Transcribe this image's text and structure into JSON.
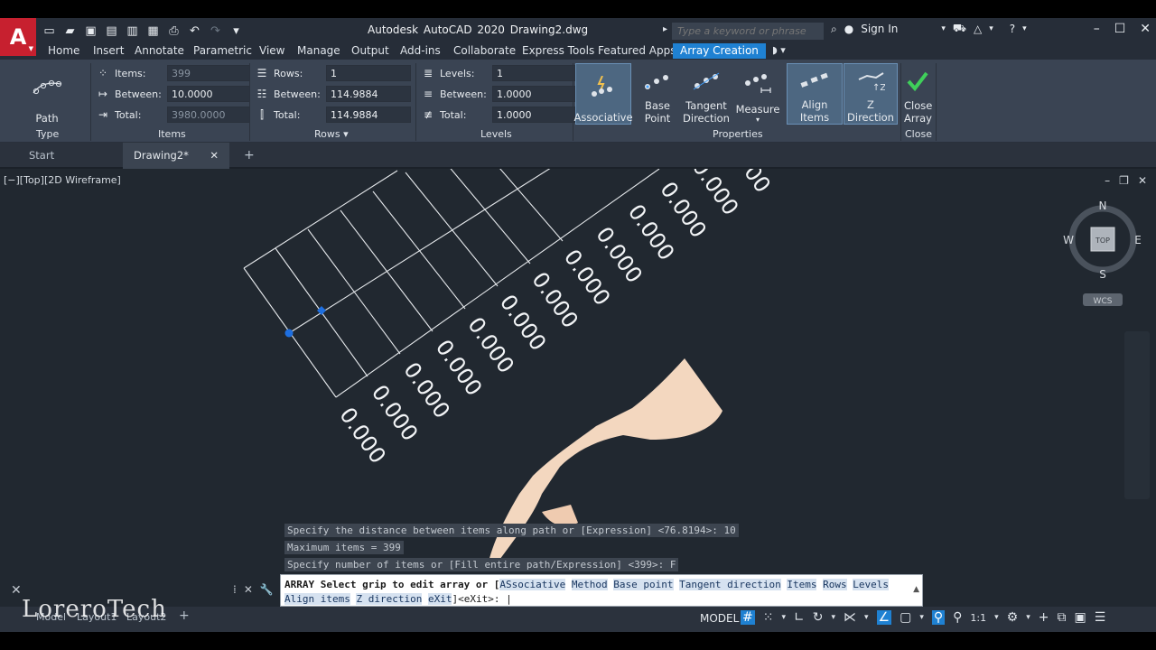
{
  "app": {
    "logo_letter": "A",
    "title": "Autodesk AutoCAD 2020   Drawing2.dwg",
    "search_placeholder": "Type a keyword or phrase",
    "sign_in": "Sign In"
  },
  "ribbon_tabs": [
    "Home",
    "Insert",
    "Annotate",
    "Parametric",
    "View",
    "Manage",
    "Output",
    "Add-ins",
    "Collaborate",
    "Express Tools",
    "Featured Apps",
    "Array Creation"
  ],
  "ribbon": {
    "type_panel": {
      "button": "Path",
      "title": "Type"
    },
    "items_panel": {
      "title": "Items",
      "items_label": "Items:",
      "items_value": "399",
      "between_label": "Between:",
      "between_value": "10.0000",
      "total_label": "Total:",
      "total_value": "3980.0000"
    },
    "rows_panel": {
      "title": "Rows ▾",
      "rows_label": "Rows:",
      "rows_value": "1",
      "between_label": "Between:",
      "between_value": "114.9884",
      "total_label": "Total:",
      "total_value": "114.9884"
    },
    "levels_panel": {
      "title": "Levels",
      "levels_label": "Levels:",
      "levels_value": "1",
      "between_label": "Between:",
      "between_value": "1.0000",
      "total_label": "Total:",
      "total_value": "1.0000"
    },
    "properties_panel": {
      "title": "Properties",
      "associative": "Associative",
      "base_point": "Base Point",
      "tangent_direction": "Tangent Direction",
      "measure": "Measure",
      "align_items": "Align Items",
      "z_direction": "Z Direction"
    },
    "close_panel": {
      "button": "Close Array",
      "title": "Close"
    }
  },
  "file_tabs": {
    "start": "Start",
    "drawing": "Drawing2*"
  },
  "viewport": {
    "label": "[−][Top][2D Wireframe]",
    "array_text": "0.000",
    "viewcube": {
      "n": "N",
      "s": "S",
      "e": "E",
      "w": "W",
      "top": "TOP",
      "wcs": "WCS"
    }
  },
  "command": {
    "history": [
      "Specify the distance between items along path or [Expression] <76.8194>: 10",
      "Maximum items = 399",
      "Specify number of items or [Fill entire path/Expression] <399>: F"
    ],
    "prompt_prefix": "ARRAY Select grip to edit array or [",
    "options": [
      "ASsociative",
      "Method",
      "Base point",
      "Tangent direction",
      "Items",
      "Rows",
      "Levels",
      "Align items",
      "Z direction",
      "eXit"
    ],
    "prompt_suffix": "]<eXit>: "
  },
  "status": {
    "model": "MODEL",
    "scale": "1:1",
    "layout_tabs": [
      "Model",
      "Layout1",
      "Layout2"
    ]
  },
  "watermark": "LoreroTech",
  "colors": {
    "accent": "#1f81d2",
    "autocad_red": "#c7202f",
    "grip": "#1e6fe0"
  }
}
